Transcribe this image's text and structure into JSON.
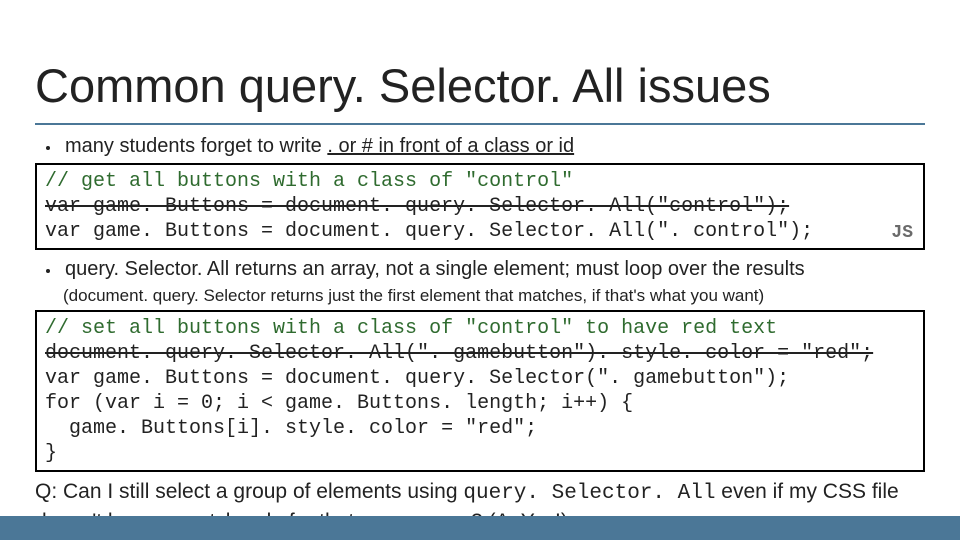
{
  "title": "Common query. Selector. All issues",
  "bullet1": {
    "prefix": "many students forget to write ",
    "underlined": ". or # in front of a class or id"
  },
  "code1": {
    "comment": "// get all buttons with a class of \"control\"",
    "wrong": "var game. Buttons = document. query. Selector. All(\"control\");",
    "right": "var game. Buttons = document. query. Selector. All(\". control\");",
    "label": "JS"
  },
  "bullet2": "query. Selector. All returns an array, not a single element; must loop over the results",
  "subnote": "(document. query. Selector returns just the first element that matches, if that's what you want)",
  "code2": {
    "comment": "// set all buttons with a class of \"control\" to have red text",
    "wrong": "document. query. Selector. All(\". gamebutton\"). style. color = \"red\";",
    "line3": "var game. Buttons = document. query. Selector(\". gamebutton\");",
    "line4": "for (var i = 0; i < game. Buttons. length; i++) {",
    "line5": "  game. Buttons[i]. style. color = \"red\";",
    "line6": "}"
  },
  "qa": {
    "q_prefix": "Q: Can I still select a group of elements using ",
    "q_code": "query. Selector. All",
    "q_suffix": " even if my CSS file doesn't have any style rule for that same group? (A: Yes!)"
  }
}
